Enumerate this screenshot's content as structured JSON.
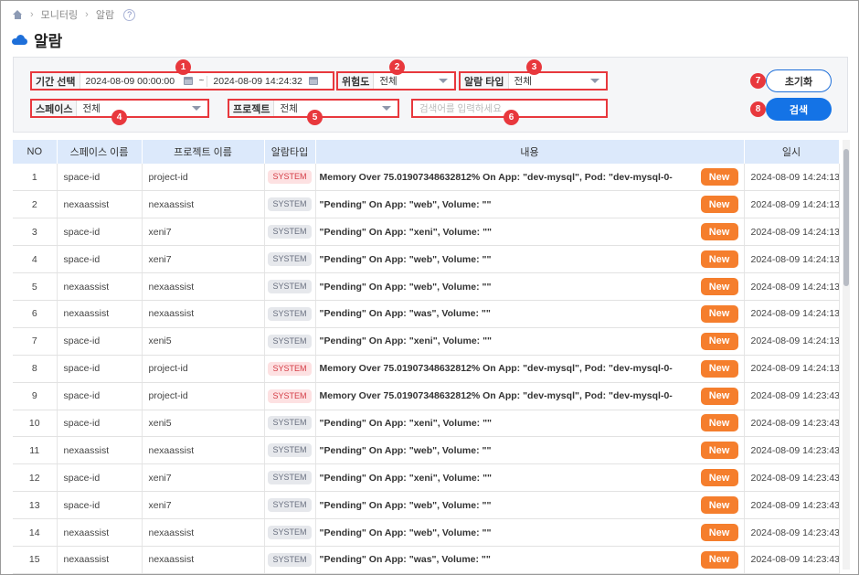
{
  "breadcrumb": {
    "item1": "모니터링",
    "item2": "알람",
    "help": "?"
  },
  "page": {
    "title": "알람"
  },
  "filters": {
    "period_label": "기간 선택",
    "period_start": "2024-08-09 00:00:00",
    "period_sep": "~",
    "period_end": "2024-08-09 14:24:32",
    "severity_label": "위험도",
    "severity_value": "전체",
    "alarm_type_label": "알람 타입",
    "alarm_type_value": "전체",
    "space_label": "스페이스",
    "space_value": "전체",
    "project_label": "프로젝트",
    "project_value": "전체",
    "search_placeholder": "검색어를 입력하세요"
  },
  "badges": [
    "1",
    "2",
    "3",
    "4",
    "5",
    "6",
    "7",
    "8"
  ],
  "buttons": {
    "reset": "초기화",
    "search": "검색"
  },
  "table": {
    "headers": [
      "NO",
      "스페이스 이름",
      "프로젝트 이름",
      "알람타입",
      "내용",
      "일시"
    ],
    "rows": [
      {
        "no": "1",
        "space": "space-id",
        "project": "project-id",
        "type": "SYSTEM",
        "type_style": "red",
        "content": "Memory Over 75.01907348632812%  On App: \"dev-mysql\", Pod: \"dev-mysql-0-",
        "new": "New",
        "time": "2024-08-09 14:24:13"
      },
      {
        "no": "2",
        "space": "nexaassist",
        "project": "nexaassist",
        "type": "SYSTEM",
        "type_style": "gray",
        "content": "\"Pending\" On App: \"web\", Volume: \"\"",
        "new": "New",
        "time": "2024-08-09 14:24:13"
      },
      {
        "no": "3",
        "space": "space-id",
        "project": "xeni7",
        "type": "SYSTEM",
        "type_style": "gray",
        "content": "\"Pending\" On App: \"xeni\", Volume: \"\"",
        "new": "New",
        "time": "2024-08-09 14:24:13"
      },
      {
        "no": "4",
        "space": "space-id",
        "project": "xeni7",
        "type": "SYSTEM",
        "type_style": "gray",
        "content": "\"Pending\" On App: \"web\", Volume: \"\"",
        "new": "New",
        "time": "2024-08-09 14:24:13"
      },
      {
        "no": "5",
        "space": "nexaassist",
        "project": "nexaassist",
        "type": "SYSTEM",
        "type_style": "gray",
        "content": "\"Pending\" On App: \"web\", Volume: \"\"",
        "new": "New",
        "time": "2024-08-09 14:24:13"
      },
      {
        "no": "6",
        "space": "nexaassist",
        "project": "nexaassist",
        "type": "SYSTEM",
        "type_style": "gray",
        "content": "\"Pending\" On App: \"was\", Volume: \"\"",
        "new": "New",
        "time": "2024-08-09 14:24:13"
      },
      {
        "no": "7",
        "space": "space-id",
        "project": "xeni5",
        "type": "SYSTEM",
        "type_style": "gray",
        "content": "\"Pending\" On App: \"xeni\", Volume: \"\"",
        "new": "New",
        "time": "2024-08-09 14:24:13"
      },
      {
        "no": "8",
        "space": "space-id",
        "project": "project-id",
        "type": "SYSTEM",
        "type_style": "red",
        "content": "Memory Over 75.01907348632812%  On App: \"dev-mysql\", Pod: \"dev-mysql-0-",
        "new": "New",
        "time": "2024-08-09 14:24:13"
      },
      {
        "no": "9",
        "space": "space-id",
        "project": "project-id",
        "type": "SYSTEM",
        "type_style": "red",
        "content": "Memory Over 75.01907348632812%  On App: \"dev-mysql\", Pod: \"dev-mysql-0-",
        "new": "New",
        "time": "2024-08-09 14:23:43"
      },
      {
        "no": "10",
        "space": "space-id",
        "project": "xeni5",
        "type": "SYSTEM",
        "type_style": "gray",
        "content": "\"Pending\" On App: \"xeni\", Volume: \"\"",
        "new": "New",
        "time": "2024-08-09 14:23:43"
      },
      {
        "no": "11",
        "space": "nexaassist",
        "project": "nexaassist",
        "type": "SYSTEM",
        "type_style": "gray",
        "content": "\"Pending\" On App: \"web\", Volume: \"\"",
        "new": "New",
        "time": "2024-08-09 14:23:43"
      },
      {
        "no": "12",
        "space": "space-id",
        "project": "xeni7",
        "type": "SYSTEM",
        "type_style": "gray",
        "content": "\"Pending\" On App: \"xeni\", Volume: \"\"",
        "new": "New",
        "time": "2024-08-09 14:23:43"
      },
      {
        "no": "13",
        "space": "space-id",
        "project": "xeni7",
        "type": "SYSTEM",
        "type_style": "gray",
        "content": "\"Pending\" On App: \"web\", Volume: \"\"",
        "new": "New",
        "time": "2024-08-09 14:23:43"
      },
      {
        "no": "14",
        "space": "nexaassist",
        "project": "nexaassist",
        "type": "SYSTEM",
        "type_style": "gray",
        "content": "\"Pending\" On App: \"web\", Volume: \"\"",
        "new": "New",
        "time": "2024-08-09 14:23:43"
      },
      {
        "no": "15",
        "space": "nexaassist",
        "project": "nexaassist",
        "type": "SYSTEM",
        "type_style": "gray",
        "content": "\"Pending\" On App: \"was\", Volume: \"\"",
        "new": "New",
        "time": "2024-08-09 14:23:43"
      }
    ]
  },
  "colors": {
    "accent": "#1473e6",
    "highlight": "#e8383d",
    "new_badge": "#f57e2d",
    "header_bg": "#dce9fb"
  }
}
